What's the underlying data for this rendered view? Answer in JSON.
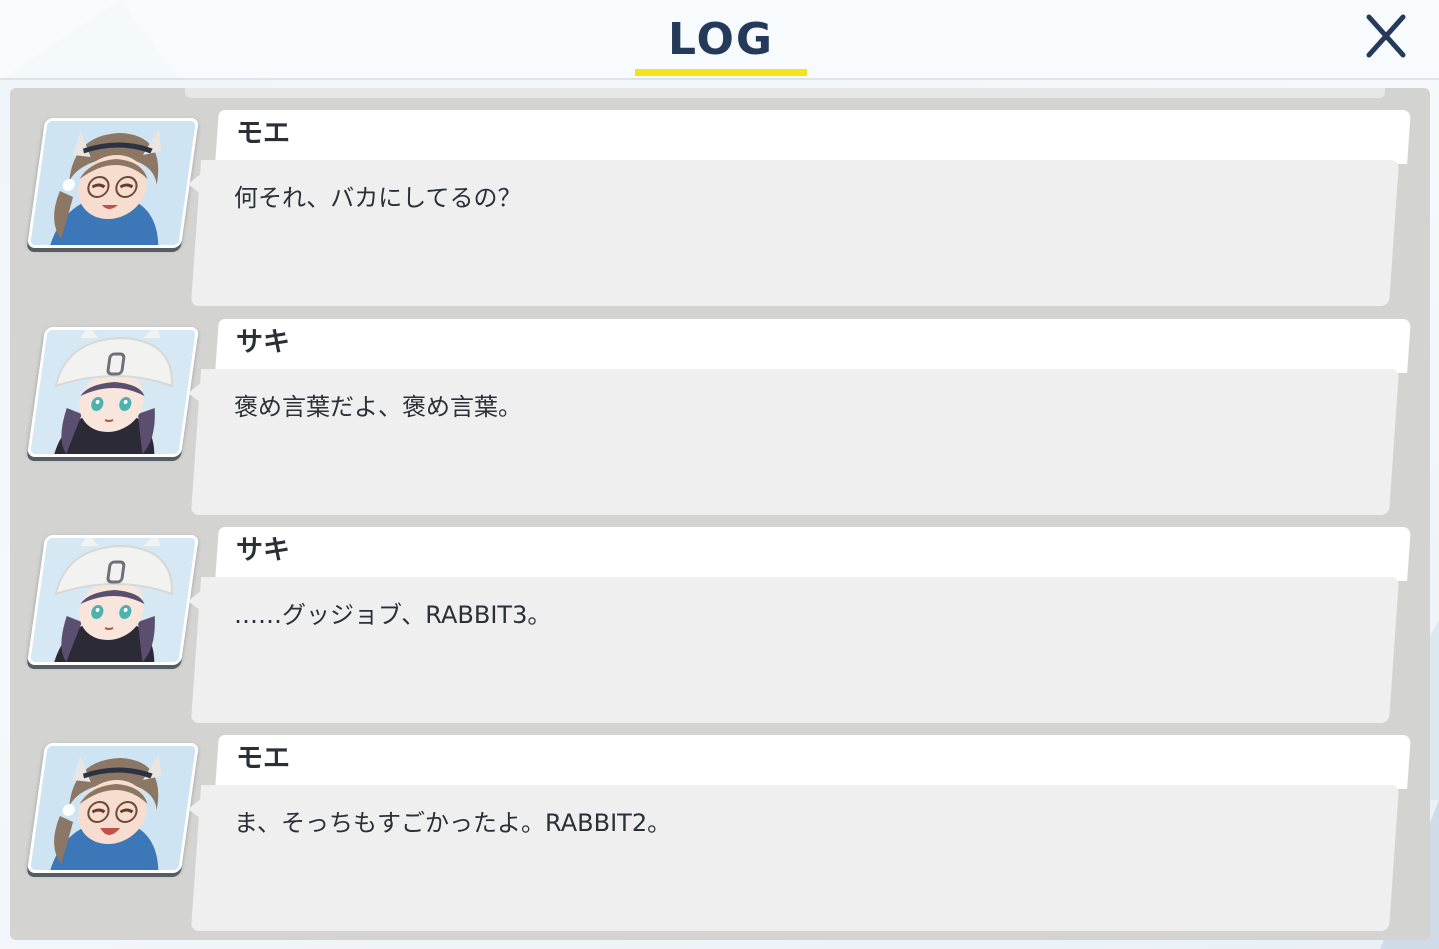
{
  "header": {
    "title": "LOG",
    "close_icon": "close-icon",
    "accent_color": "#f4e31a",
    "title_color": "#25395a"
  },
  "log": {
    "entries": [
      {
        "speaker": "モエ",
        "text": "何それ、バカにしてるの？",
        "avatar": "moe-portrait"
      },
      {
        "speaker": "サキ",
        "text": "褒め言葉だよ、褒め言葉。",
        "avatar": "saki-portrait"
      },
      {
        "speaker": "サキ",
        "text": "……グッジョブ、RABBIT3。",
        "avatar": "saki-portrait"
      },
      {
        "speaker": "モエ",
        "text": "ま、そっちもすごかったよ。RABBIT2。",
        "avatar": "moe-portrait"
      }
    ]
  }
}
